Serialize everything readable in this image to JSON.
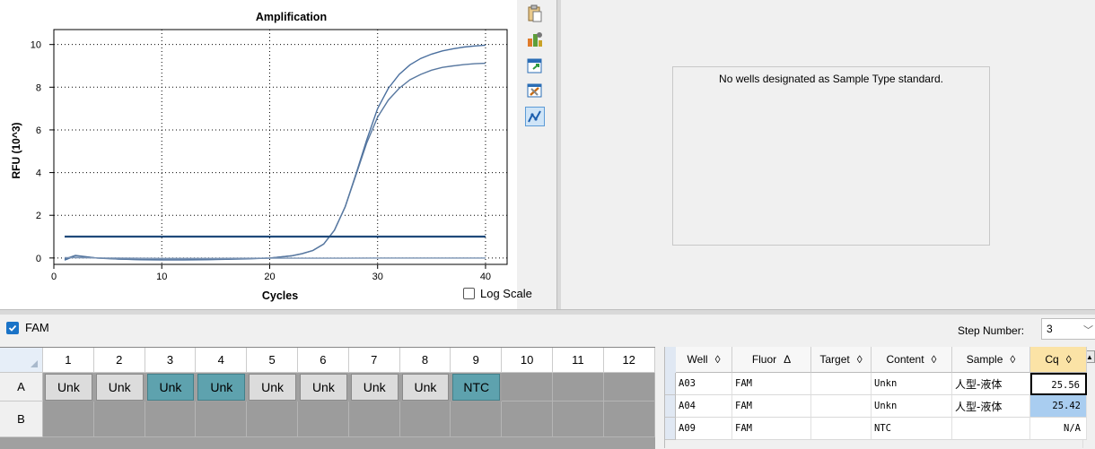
{
  "chart_data": {
    "type": "line",
    "title": "Amplification",
    "xlabel": "Cycles",
    "ylabel": "RFU (10^3)",
    "xlim": [
      0,
      42
    ],
    "ylim": [
      -0.3,
      10.7
    ],
    "xticks": [
      0,
      10,
      20,
      30,
      40
    ],
    "yticks": [
      0,
      2,
      4,
      6,
      8,
      10
    ],
    "grid": true,
    "threshold": 1.0,
    "series": [
      {
        "x": [
          1,
          2,
          3,
          4,
          5,
          6,
          8,
          10,
          12,
          14,
          16,
          18,
          20,
          21,
          22,
          23,
          24,
          25,
          26,
          27,
          28,
          29,
          30,
          31,
          32,
          33,
          34,
          35,
          36,
          37,
          38,
          39,
          40
        ],
        "y": [
          -0.1,
          0.1,
          0.05,
          0.0,
          -0.02,
          -0.05,
          -0.08,
          -0.09,
          -0.09,
          -0.08,
          -0.06,
          -0.04,
          0.0,
          0.05,
          0.1,
          0.2,
          0.35,
          0.65,
          1.3,
          2.4,
          3.95,
          5.55,
          7.0,
          7.95,
          8.6,
          9.05,
          9.35,
          9.55,
          9.7,
          9.8,
          9.88,
          9.93,
          9.97
        ],
        "color": "#4a6f9e"
      },
      {
        "x": [
          1,
          2,
          3,
          4,
          5,
          6,
          8,
          10,
          12,
          14,
          16,
          18,
          20,
          21,
          22,
          23,
          24,
          25,
          26,
          27,
          28,
          29,
          30,
          31,
          32,
          33,
          34,
          35,
          36,
          37,
          38,
          39,
          40
        ],
        "y": [
          -0.05,
          0.12,
          0.06,
          0.0,
          -0.03,
          -0.05,
          -0.07,
          -0.08,
          -0.08,
          -0.07,
          -0.05,
          -0.03,
          0.0,
          0.05,
          0.1,
          0.2,
          0.35,
          0.65,
          1.3,
          2.4,
          3.9,
          5.4,
          6.6,
          7.4,
          7.95,
          8.35,
          8.6,
          8.8,
          8.93,
          9.0,
          9.06,
          9.1,
          9.12
        ],
        "color": "#5878a0"
      },
      {
        "x": [
          1,
          5,
          10,
          15,
          20,
          25,
          30,
          35,
          40
        ],
        "y": [
          0.02,
          0.0,
          -0.02,
          -0.02,
          -0.01,
          -0.01,
          0.0,
          0.0,
          0.0
        ],
        "color": "#7a93b4"
      }
    ]
  },
  "toolbar": {
    "icons": [
      "clipboard-icon",
      "bar-chart-settings-icon",
      "export-icon",
      "tools-icon",
      "trace-icon"
    ]
  },
  "log_scale_label": "Log Scale",
  "std_message": "No wells designated as Sample Type standard.",
  "fluor": {
    "label": "FAM",
    "checked": true
  },
  "step": {
    "label": "Step Number:",
    "value": "3"
  },
  "plate": {
    "columns": [
      "1",
      "2",
      "3",
      "4",
      "5",
      "6",
      "7",
      "8",
      "9",
      "10",
      "11",
      "12"
    ],
    "rows": [
      "A",
      "B"
    ],
    "row_a": [
      {
        "label": "Unk",
        "state": "unk"
      },
      {
        "label": "Unk",
        "state": "unk"
      },
      {
        "label": "Unk",
        "state": "sel"
      },
      {
        "label": "Unk",
        "state": "sel"
      },
      {
        "label": "Unk",
        "state": "unk"
      },
      {
        "label": "Unk",
        "state": "unk"
      },
      {
        "label": "Unk",
        "state": "unk"
      },
      {
        "label": "Unk",
        "state": "unk"
      },
      {
        "label": "NTC",
        "state": "sel"
      },
      {
        "label": "",
        "state": "empty"
      },
      {
        "label": "",
        "state": "empty"
      },
      {
        "label": "",
        "state": "empty"
      }
    ]
  },
  "table": {
    "headers": [
      {
        "label": "Well",
        "sort": "◊"
      },
      {
        "label": "Fluor",
        "sort": "Δ"
      },
      {
        "label": "Target",
        "sort": "◊"
      },
      {
        "label": "Content",
        "sort": "◊"
      },
      {
        "label": "Sample",
        "sort": "◊"
      },
      {
        "label": "Cq",
        "sort": "◊"
      }
    ],
    "rows": [
      {
        "well": "A03",
        "fluor": "FAM",
        "target": "",
        "content": "Unkn",
        "sample": "人型-液体",
        "cq": "25.56"
      },
      {
        "well": "A04",
        "fluor": "FAM",
        "target": "",
        "content": "Unkn",
        "sample": "人型-液体",
        "cq": "25.42"
      },
      {
        "well": "A09",
        "fluor": "FAM",
        "target": "",
        "content": "NTC",
        "sample": "",
        "cq": "N/A"
      }
    ]
  }
}
